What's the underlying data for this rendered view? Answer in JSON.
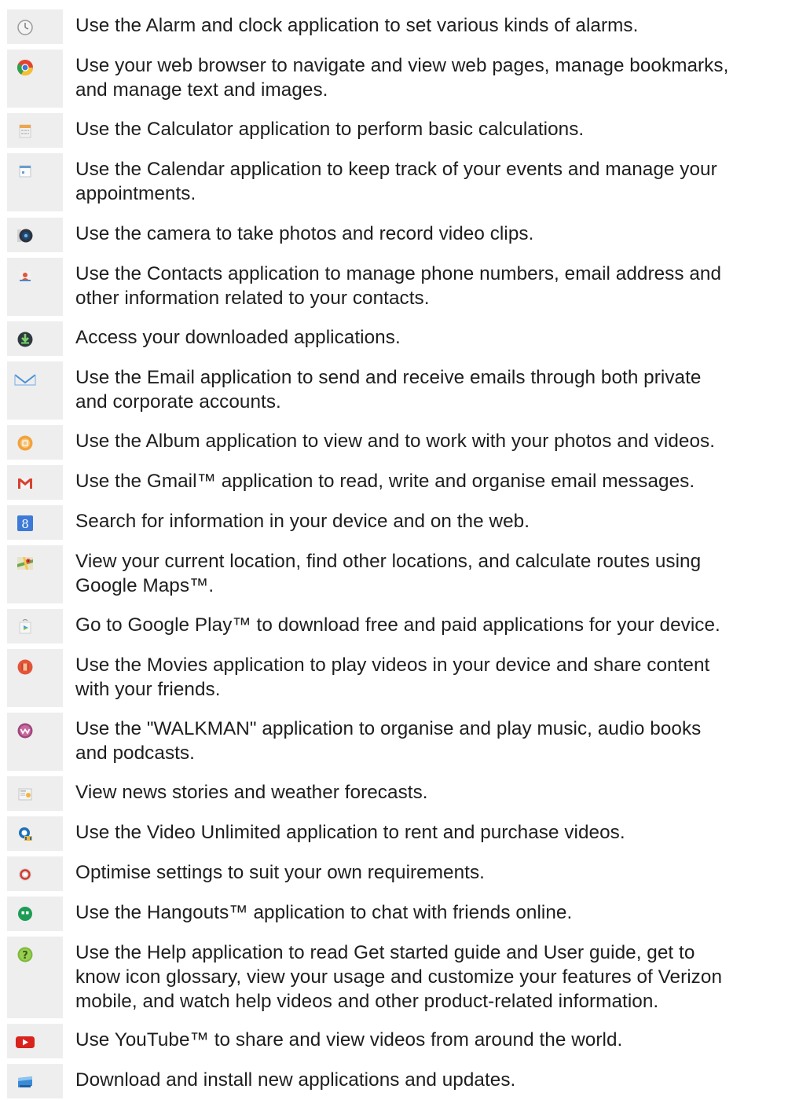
{
  "entries": [
    {
      "icon": "alarm-clock-icon",
      "text": [
        "Use the Alarm and clock application to set various kinds of alarms."
      ]
    },
    {
      "icon": "web-browser-icon",
      "text": [
        "Use your web browser to navigate and view web pages, manage bookmarks,",
        "and manage text and images."
      ]
    },
    {
      "icon": "calculator-icon",
      "text": [
        "Use the Calculator application to perform basic calculations."
      ]
    },
    {
      "icon": "calendar-icon",
      "text": [
        "Use the Calendar application to keep track of your events and manage your",
        "appointments."
      ]
    },
    {
      "icon": "camera-icon",
      "text": [
        "Use the camera to take photos and record video clips."
      ]
    },
    {
      "icon": "contacts-icon",
      "text": [
        "Use the Contacts application to manage phone numbers, email address and",
        "other information related to your contacts."
      ]
    },
    {
      "icon": "downloads-icon",
      "text": [
        "Access your downloaded applications."
      ]
    },
    {
      "icon": "email-icon",
      "text": [
        "Use the Email application to send and receive emails through both private",
        "and corporate accounts."
      ]
    },
    {
      "icon": "album-icon",
      "text": [
        "Use the Album application to view and to work with your photos and videos."
      ]
    },
    {
      "icon": "gmail-icon",
      "text": [
        "Use the Gmail™ application to read, write and organise email messages."
      ]
    },
    {
      "icon": "google-search-icon",
      "text": [
        "Search for information in your device and on the web."
      ]
    },
    {
      "icon": "maps-icon",
      "text": [
        "View your current location, find other locations, and calculate routes using",
        "Google Maps™."
      ]
    },
    {
      "icon": "play-store-icon",
      "text": [
        "Go to Google Play™ to download free and paid applications for your device."
      ]
    },
    {
      "icon": "movies-icon",
      "text": [
        "Use the Movies application to play videos in your device and share content",
        "with your friends."
      ]
    },
    {
      "icon": "walkman-icon",
      "text": [
        "Use the \"WALKMAN\" application to organise and play music, audio books",
        "and podcasts."
      ]
    },
    {
      "icon": "news-weather-icon",
      "text": [
        "View news stories and weather forecasts."
      ]
    },
    {
      "icon": "video-unlimited-icon",
      "text": [
        "Use the Video Unlimited application to rent and purchase videos."
      ]
    },
    {
      "icon": "settings-icon",
      "text": [
        "Optimise settings to suit your own requirements."
      ]
    },
    {
      "icon": "hangouts-icon",
      "text": [
        "Use the Hangouts™ application to chat with friends online."
      ]
    },
    {
      "icon": "help-icon",
      "text": [
        "Use the Help application to read Get started guide and User guide, get to",
        "know icon glossary, view your usage and customize your features of Verizon",
        "mobile, and watch help videos and other product-related information."
      ]
    },
    {
      "icon": "youtube-icon",
      "text": [
        "Use YouTube™ to share and view videos from around the world."
      ]
    },
    {
      "icon": "app-store-icon",
      "text": [
        "Download and install new applications and updates."
      ]
    }
  ]
}
